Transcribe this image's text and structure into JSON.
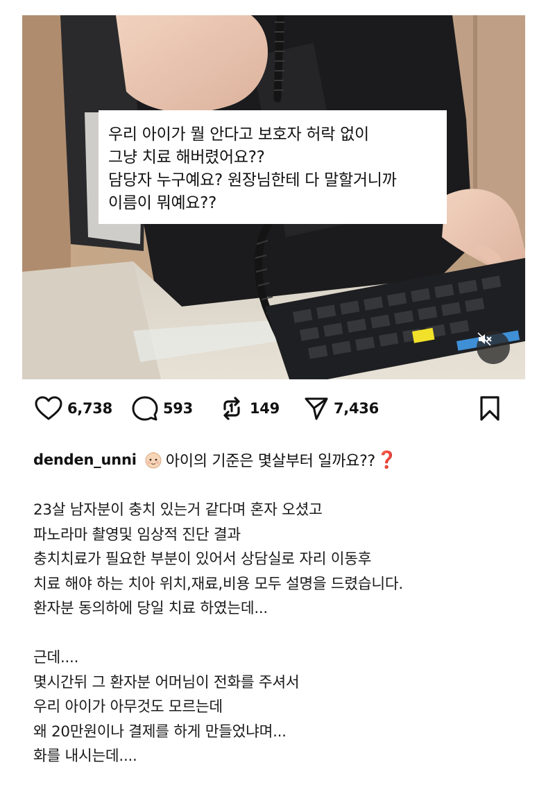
{
  "video": {
    "overlay_lines": [
      "우리 아이가 뭘 안다고 보호자 허락 없이",
      "그냥 치료 해버렸어요??",
      "담당자 누구예요? 원장님한테 다 말할거니까",
      "이름이 뭐예요??"
    ],
    "mute_icon": "speaker-muted-icon"
  },
  "actions": {
    "likes": "6,738",
    "comments": "593",
    "reposts": "149",
    "shares": "7,436"
  },
  "post": {
    "username": "denden_unni",
    "headline": "아이의 기준은 몇살부터 일까요??",
    "headline_emoji": "baby-face-icon",
    "headline_mark": "❓",
    "paragraph1": [
      "23살 남자분이 충치 있는거 같다며 혼자 오셨고",
      "파노라마 촬영및 임상적 진단 결과",
      "충치치료가 필요한 부분이 있어서 상담실로 자리 이동후",
      "치료 해야 하는 치아 위치,재료,비용 모두 설명을 드렸습니다.",
      "환자분 동의하에 당일 치료 하였는데..."
    ],
    "paragraph2": [
      "근데....",
      "몇시간뒤 그 환자분 어머님이 전화를 주셔서",
      "우리 아이가 아무것도 모르는데",
      "왜 20만원이나 결제를 하게 만들었냐며...",
      "화를 내시는데...."
    ]
  },
  "colors": {
    "accent_red": "#e0281c",
    "text": "#111111"
  }
}
